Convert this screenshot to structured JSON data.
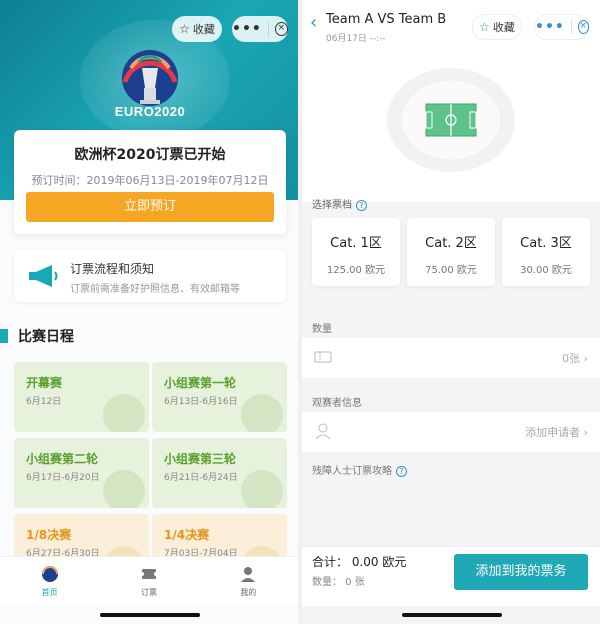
{
  "left": {
    "header": {
      "fav_icon": "star-icon",
      "fav_label": "收藏",
      "menu_label": "•••",
      "close_icon": "close-circle-icon",
      "logo_text": "EURO2020"
    },
    "promo": {
      "title": "欧洲杯2020订票已开始",
      "period_label": "预订时间：2019年06月13日-2019年07月12日",
      "button_label": "立即预订",
      "button_color": "#f5a623"
    },
    "notice": {
      "icon": "megaphone-icon",
      "title": "订票流程和须知",
      "subtitle": "订票前需准备好护照信息、有效邮箱等"
    },
    "schedule": {
      "title": "比赛日程",
      "accent_color": "#19a8b7",
      "items": [
        {
          "name": "开幕赛",
          "date": "6月12日",
          "tone": "green"
        },
        {
          "name": "小组赛第一轮",
          "date": "6月13日-6月16日",
          "tone": "green"
        },
        {
          "name": "小组赛第二轮",
          "date": "6月17日-6月20日",
          "tone": "green"
        },
        {
          "name": "小组赛第三轮",
          "date": "6月21日-6月24日",
          "tone": "green"
        },
        {
          "name": "1/8决赛",
          "date": "6月27日-6月30日",
          "tone": "orange"
        },
        {
          "name": "1/4决赛",
          "date": "7月03日-7月04日",
          "tone": "orange"
        }
      ]
    },
    "tabbar": {
      "tabs": [
        {
          "label": "首页",
          "icon": "home-ball-icon",
          "active": true
        },
        {
          "label": "订票",
          "icon": "ticket-icon",
          "active": false
        },
        {
          "label": "我的",
          "icon": "user-icon",
          "active": false
        }
      ]
    }
  },
  "right": {
    "nav": {
      "back_icon": "chevron-left-icon",
      "title": "Team A VS Team B",
      "subtitle": "06月17日 --:--",
      "fav_label": "收藏",
      "menu_label": "•••"
    },
    "stadium_icon": "stadium-icon",
    "ticket_tier": {
      "label": "选择票档",
      "categories": [
        {
          "name": "Cat. 1区",
          "price": "125.00 欧元"
        },
        {
          "name": "Cat. 2区",
          "price": "75.00 欧元"
        },
        {
          "name": "Cat. 3区",
          "price": "30.00 欧元"
        }
      ]
    },
    "quantity": {
      "label": "数量",
      "icon": "ticket-icon",
      "value": "0张"
    },
    "attendee": {
      "label": "观赛者信息",
      "icon": "user-icon",
      "value": "添加申请者"
    },
    "disabled_guide": {
      "label": "残障人士订票攻略"
    },
    "footer": {
      "total": "合计： 0.00 欧元",
      "quantity": "数量： 0 张",
      "button_label": "添加到我的票务",
      "button_color": "#1fa9b6"
    }
  }
}
